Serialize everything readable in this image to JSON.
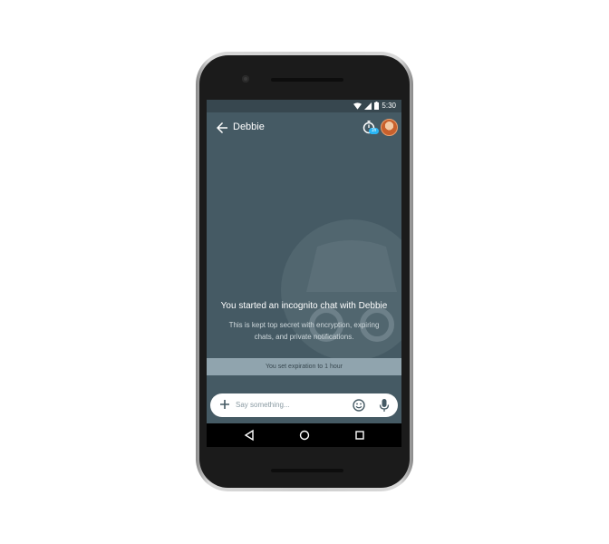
{
  "status_bar": {
    "time": "5:30"
  },
  "conversation": {
    "title": "Debbie",
    "timer_badge": "1h"
  },
  "incognito": {
    "heading": "You started an incognito chat with Debbie",
    "description": "This is kept top secret with encryption, expiring chats, and private notifications.",
    "expiration_notice": "You set expiration to 1 hour"
  },
  "composer": {
    "placeholder": "Say something..."
  },
  "colors": {
    "screen_bg": "#455a64",
    "status_bar_bg": "#37474f",
    "expiry_band": "#90a4ae",
    "timer_badge": "#29b6f6"
  },
  "icons": [
    "back-arrow-icon",
    "timer-icon",
    "add-icon",
    "emoji-icon",
    "mic-icon",
    "nav-back-icon",
    "nav-home-icon",
    "nav-recents-icon",
    "wifi-icon",
    "signal-icon",
    "battery-icon"
  ]
}
